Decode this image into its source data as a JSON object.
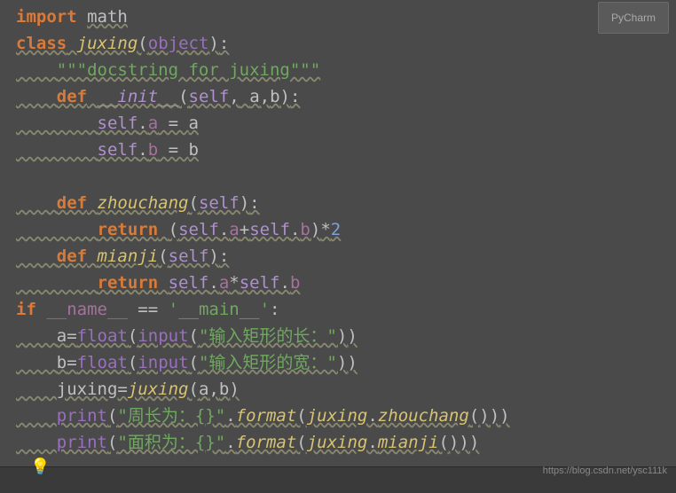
{
  "ide_badge": "PyCharm",
  "code": {
    "l1": {
      "kw_import": "import",
      "module": "math"
    },
    "l2": {
      "kw_class": "class",
      "name": "juxing",
      "paren_o": "(",
      "base": "object",
      "paren_c": ")",
      "colon": ":"
    },
    "l3": {
      "indent": "    ",
      "doc": "\"\"\"docstring for juxing\"\"\""
    },
    "l4": {
      "indent": "    ",
      "kw_def": "def",
      "name": "__init__",
      "paren_o": "(",
      "p_self": "self",
      "comma1": ",",
      "sp1": " ",
      "p_a": "a",
      "comma2": ",",
      "p_b": "b",
      "paren_c": ")",
      "colon": ":"
    },
    "l5": {
      "indent": "        ",
      "self": "self",
      "dot": ".",
      "attr": "a",
      "eq": " = ",
      "val": "a"
    },
    "l6": {
      "indent": "        ",
      "self": "self",
      "dot": ".",
      "attr": "b",
      "eq": " = ",
      "val": "b"
    },
    "l7": {
      "blank": " "
    },
    "l8": {
      "indent": "    ",
      "kw_def": "def",
      "name": "zhouchang",
      "paren_o": "(",
      "p_self": "self",
      "paren_c": ")",
      "colon": ":"
    },
    "l9": {
      "indent": "        ",
      "kw_return": "return",
      "sp": " ",
      "paren_o": "(",
      "self1": "self",
      "dot1": ".",
      "a1": "a",
      "plus": "+",
      "self2": "self",
      "dot2": ".",
      "a2": "b",
      "paren_c": ")",
      "mul": "*",
      "num": "2"
    },
    "l10": {
      "indent": "    ",
      "kw_def": "def",
      "name": "mianji",
      "paren_o": "(",
      "p_self": "self",
      "paren_c": ")",
      "colon": ":"
    },
    "l11": {
      "indent": "        ",
      "kw_return": "return",
      "sp": " ",
      "self1": "self",
      "dot1": ".",
      "a1": "a",
      "mul": "*",
      "self2": "self",
      "dot2": ".",
      "a2": "b"
    },
    "l12": {
      "kw_if": "if",
      "sp": " ",
      "name": "__name__",
      "eq": " == ",
      "str": "'__main__'",
      "colon": ":"
    },
    "l13": {
      "indent": "    ",
      "var": "a",
      "eq": "=",
      "float": "float",
      "po1": "(",
      "input": "input",
      "po2": "(",
      "str": "\"输入矩形的长：\"",
      "pc2": ")",
      "pc1": ")"
    },
    "l14": {
      "indent": "    ",
      "var": "b",
      "eq": "=",
      "float": "float",
      "po1": "(",
      "input": "input",
      "po2": "(",
      "str": "\"输入矩形的宽：\"",
      "pc2": ")",
      "pc1": ")"
    },
    "l15": {
      "indent": "    ",
      "var": "juxing",
      "eq": "=",
      "cls": "juxing",
      "po": "(",
      "a": "a",
      "comma": ",",
      "b": "b",
      "pc": ")"
    },
    "l16": {
      "indent": "    ",
      "print": "print",
      "po1": "(",
      "str": "\"周长为：{}\"",
      "dot": ".",
      "format": "format",
      "po2": "(",
      "obj": "juxing",
      "dot2": ".",
      "meth": "zhouchang",
      "po3": "(",
      "pc3": ")",
      "pc2": ")",
      "pc1": ")"
    },
    "l17": {
      "indent": "    ",
      "print": "print",
      "po1": "(",
      "str": "\"面积为：{}\"",
      "dot": ".",
      "format": "format",
      "po2": "(",
      "obj": "juxing",
      "dot2": ".",
      "meth": "mianji",
      "po3": "(",
      "pc3": ")",
      "pc2": ")",
      "pc1": ")"
    }
  },
  "bulb_icon": "💡",
  "watermark": "https://blog.csdn.net/ysc111k"
}
